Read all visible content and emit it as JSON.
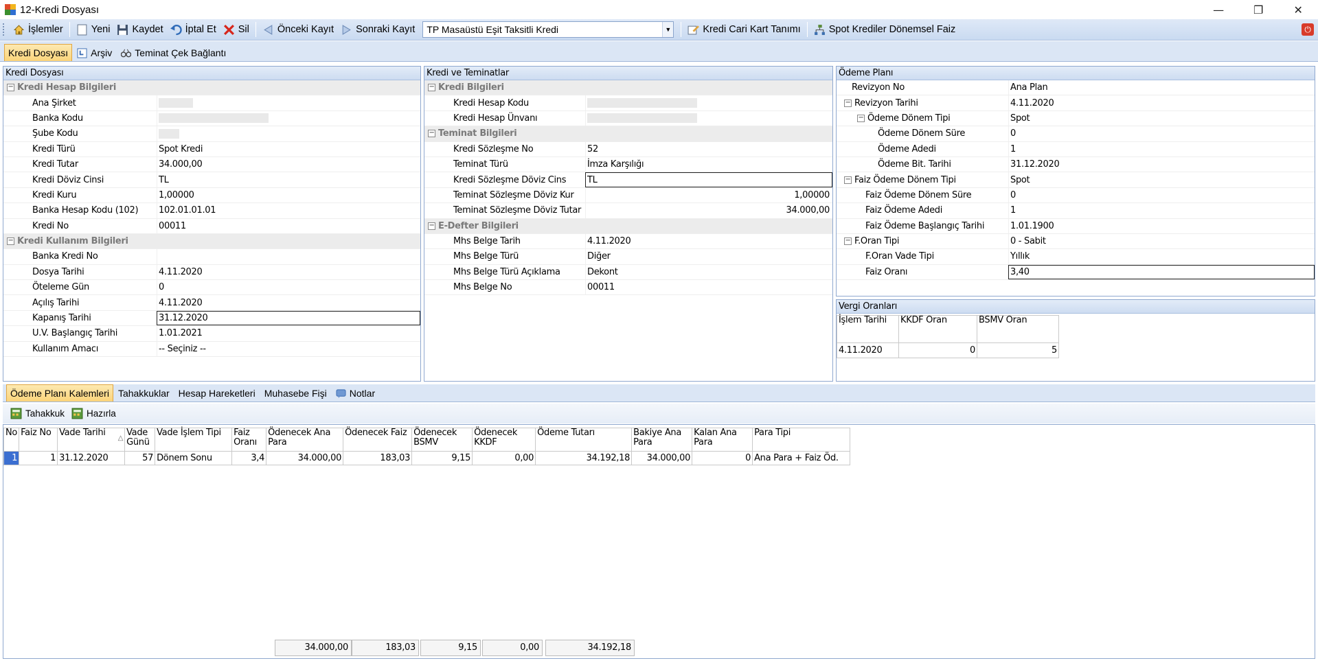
{
  "window": {
    "title": "12-Kredi Dosyası",
    "min": "—",
    "restore": "❐",
    "close": "✕"
  },
  "toolbar": {
    "islemler": "İşlemler",
    "yeni": "Yeni",
    "kaydet": "Kaydet",
    "iptal": "İptal Et",
    "sil": "Sil",
    "onceki": "Önceki Kayıt",
    "sonraki": "Sonraki Kayıt",
    "combo_value": "TP Masaüstü Eşit Taksitli Kredi",
    "cari": "Kredi Cari Kart Tanımı",
    "spot": "Spot Krediler Dönemsel Faiz"
  },
  "tabs": [
    "Kredi Dosyası",
    "Arşiv",
    "Teminat Çek Bağlantı"
  ],
  "left": {
    "header": "Kredi Dosyası",
    "cat1": "Kredi Hesap Bilgileri",
    "rows1": [
      [
        "Ana Şirket",
        ""
      ],
      [
        "Banka Kodu",
        ""
      ],
      [
        "Şube Kodu",
        ""
      ],
      [
        "Kredi Türü",
        "Spot Kredi"
      ],
      [
        "Kredi Tutar",
        "34.000,00"
      ],
      [
        "Kredi Döviz Cinsi",
        "TL"
      ],
      [
        "Kredi Kuru",
        "1,00000"
      ],
      [
        "Banka Hesap Kodu (102)",
        "102.01.01.01"
      ],
      [
        "Kredi No",
        "00011"
      ]
    ],
    "cat2": "Kredi Kullanım Bilgileri",
    "rows2": [
      [
        "Banka Kredi No",
        ""
      ],
      [
        "Dosya Tarihi",
        "4.11.2020"
      ],
      [
        "Öteleme Gün",
        "0"
      ],
      [
        "Açılış Tarihi",
        "4.11.2020"
      ],
      [
        "Kapanış Tarihi",
        "31.12.2020"
      ],
      [
        "U.V. Başlangıç Tarihi",
        "1.01.2021"
      ],
      [
        "Kullanım Amacı",
        "-- Seçiniz --"
      ]
    ]
  },
  "mid": {
    "header": "Kredi ve Teminatlar",
    "cat1": "Kredi Bilgileri",
    "rows1": [
      [
        "Kredi Hesap Kodu",
        ""
      ],
      [
        "Kredi Hesap Ünvanı",
        ""
      ]
    ],
    "cat2": "Teminat Bilgileri",
    "rows2": [
      [
        "Kredi Sözleşme No",
        "52"
      ],
      [
        "Teminat Türü",
        "İmza Karşılığı"
      ],
      [
        "Kredi Sözleşme Döviz Cins",
        "TL"
      ],
      [
        "Teminat Sözleşme Döviz Kur",
        "1,00000"
      ],
      [
        "Teminat Sözleşme Döviz Tutar",
        "34.000,00"
      ]
    ],
    "cat3": "E-Defter Bilgileri",
    "rows3": [
      [
        "Mhs Belge Tarih",
        "4.11.2020"
      ],
      [
        "Mhs Belge Türü",
        "Diğer"
      ],
      [
        "Mhs Belge Türü Açıklama",
        "Dekont"
      ],
      [
        "Mhs Belge No",
        "00011"
      ]
    ]
  },
  "right": {
    "header": "Ödeme Planı",
    "rows": [
      [
        "Revizyon No",
        "Ana Plan"
      ],
      [
        "Revizyon Tarihi",
        "4.11.2020"
      ],
      [
        "Ödeme Dönem Tipi",
        "Spot"
      ],
      [
        "Ödeme Dönem Süre",
        "0"
      ],
      [
        "Ödeme Adedi",
        "1"
      ],
      [
        "Ödeme Bit. Tarihi",
        "31.12.2020"
      ],
      [
        "Faiz Ödeme Dönem Tipi",
        "Spot"
      ],
      [
        "Faiz Ödeme Dönem Süre",
        "0"
      ],
      [
        "Faiz Ödeme Adedi",
        "1"
      ],
      [
        "Faiz Ödeme Başlangıç Tarihi",
        "1.01.1900"
      ],
      [
        "F.Oran Tipi",
        "0 - Sabit"
      ],
      [
        "F.Oran Vade Tipi",
        "Yıllık"
      ],
      [
        "Faiz Oranı",
        "3,40"
      ]
    ]
  },
  "vergi": {
    "header": "Vergi Oranları",
    "cols": [
      "İşlem Tarihi",
      "KKDF Oran",
      "BSMV Oran"
    ],
    "row": [
      "4.11.2020",
      "0",
      "5"
    ]
  },
  "bottom_tabs": [
    "Ödeme Planı Kalemleri",
    "Tahakkuklar",
    "Hesap Hareketleri",
    "Muhasebe Fişi",
    "Notlar"
  ],
  "subtoolbar": {
    "tahakkuk": "Tahakkuk",
    "hazirla": "Hazırla"
  },
  "grid": {
    "cols": [
      "No",
      "Faiz No",
      "Vade Tarihi",
      "Vade Günü",
      "Vade İşlem Tipi",
      "Faiz Oranı",
      "Ödenecek Ana Para",
      "Ödenecek Faiz",
      "Ödenecek BSMV",
      "Ödenecek KKDF",
      "Ödeme Tutarı",
      "Bakiye Ana Para",
      "Kalan Ana Para",
      "Para Tipi"
    ],
    "row": [
      "1",
      "1",
      "31.12.2020",
      "57",
      "Dönem Sonu",
      "3,4",
      "34.000,00",
      "183,03",
      "9,15",
      "0,00",
      "34.192,18",
      "34.000,00",
      "0",
      "Ana Para + Faiz Öd."
    ],
    "sort_icon": "△"
  },
  "footer": [
    "34.000,00",
    "183,03",
    "9,15",
    "0,00",
    "34.192,18"
  ],
  "icons": {
    "accent": "#fbd47a",
    "toolbar_bg": "#c9daf1"
  }
}
